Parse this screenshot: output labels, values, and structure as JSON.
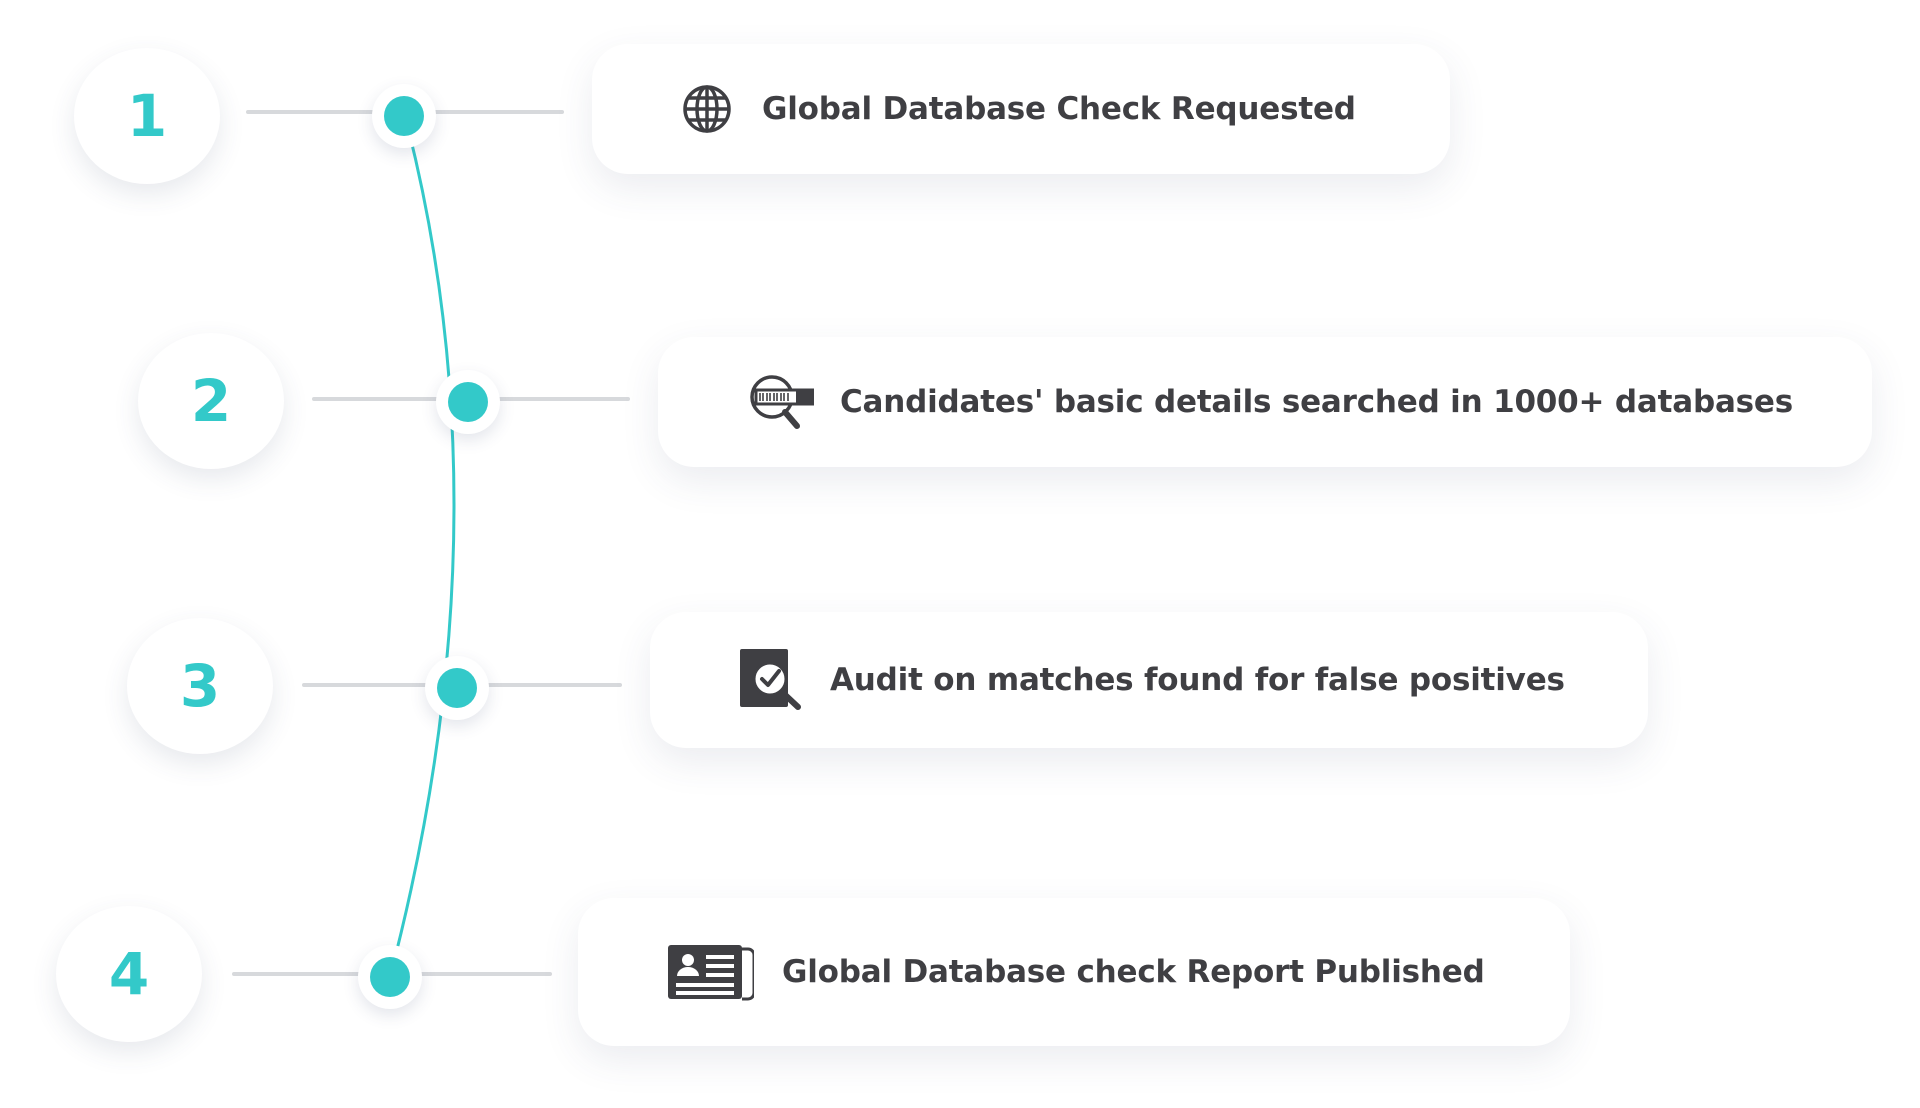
{
  "accent_color": "#33c9c9",
  "text_color": "#3f3f43",
  "connector_color": "#d7d9dc",
  "steps": [
    {
      "number": "1",
      "label": "Global Database Check Requested",
      "icon": "globe-icon"
    },
    {
      "number": "2",
      "label": "Candidates' basic details searched in 1000+ databases",
      "icon": "database-search-icon"
    },
    {
      "number": "3",
      "label": "Audit on matches found for false positives",
      "icon": "audit-check-icon"
    },
    {
      "number": "4",
      "label": "Global Database check Report Published",
      "icon": "report-card-icon"
    }
  ]
}
